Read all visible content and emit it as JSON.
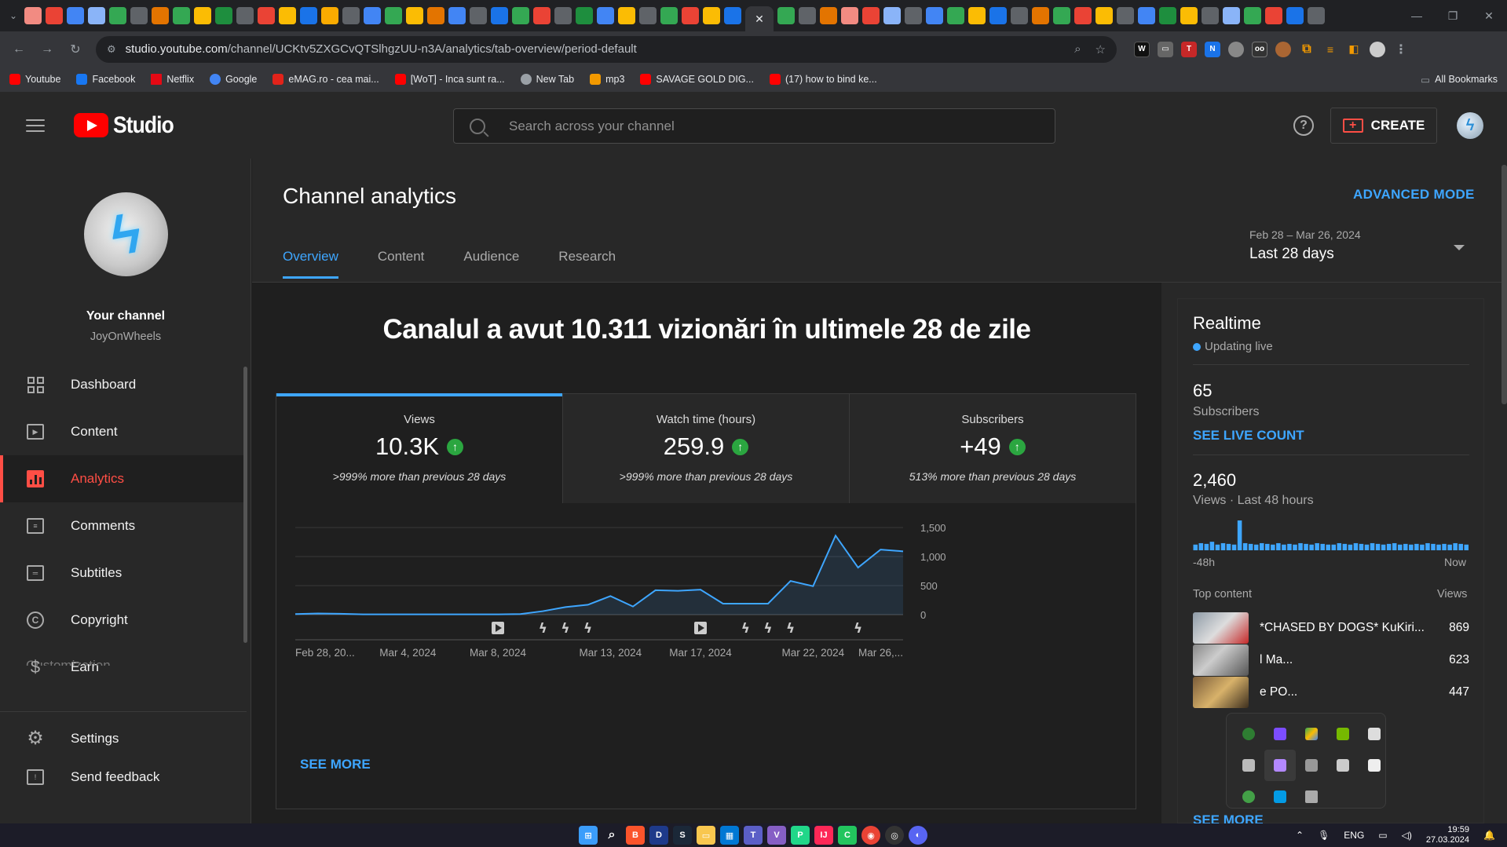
{
  "browser": {
    "url_host": "studio.youtube.com",
    "url_path": "/channel/UCKtv5ZXGCvQTSlhgzUU-n3A/analytics/tab-overview/period-default",
    "tab_favicons": [
      "#f28b82",
      "#ea4335",
      "#4285f4",
      "#8ab4f8",
      "#34a853",
      "#5f6368",
      "#e37400",
      "#34a853",
      "#fbbc04",
      "#1e8e3e",
      "#5f6368",
      "#ea4335",
      "#fbbc04",
      "#1a73e8",
      "#f9ab00",
      "#5f6368",
      "#4285f4",
      "#34a853",
      "#fbbc04",
      "#e37400",
      "#4285f4",
      "#5f6368",
      "#1a73e8",
      "#34a853",
      "#ea4335",
      "#5f6368",
      "#1e8e3e",
      "#4285f4",
      "#fbbc04",
      "#5f6368",
      "#34a853",
      "#ea4335",
      "#fbbc04",
      "#1a73e8",
      "#34a853",
      "#5f6368",
      "#e37400",
      "#f28b82",
      "#ea4335",
      "#8ab4f8",
      "#5f6368",
      "#4285f4",
      "#34a853",
      "#fbbc04",
      "#1a73e8",
      "#5f6368",
      "#e37400",
      "#34a853",
      "#ea4335",
      "#fbbc04",
      "#5f6368",
      "#4285f4",
      "#1e8e3e",
      "#fbbc04",
      "#5f6368",
      "#8ab4f8",
      "#34a853",
      "#ea4335",
      "#1a73e8",
      "#5f6368"
    ],
    "bookmarks": [
      {
        "label": "Youtube",
        "color": "#ff0000"
      },
      {
        "label": "Facebook",
        "color": "#1877f2"
      },
      {
        "label": "Netflix",
        "color": "#e50914"
      },
      {
        "label": "Google",
        "color": "#4285f4"
      },
      {
        "label": "eMAG.ro - cea mai...",
        "color": "#e2231a"
      },
      {
        "label": "[WoT] - Inca sunt ra...",
        "color": "#ff0000"
      },
      {
        "label": "New Tab",
        "color": "#9aa0a6"
      },
      {
        "label": "mp3",
        "color": "#f29900"
      },
      {
        "label": "SAVAGE GOLD DIG...",
        "color": "#ff0000"
      },
      {
        "label": "(17) how to bind ke...",
        "color": "#ff0000"
      }
    ],
    "all_bookmarks": "All Bookmarks"
  },
  "header": {
    "logo_text": "Studio",
    "search_placeholder": "Search across your channel",
    "create_label": "CREATE"
  },
  "sidebar": {
    "your_channel": "Your channel",
    "channel_name": "JoyOnWheels",
    "items": [
      {
        "label": "Dashboard",
        "icon": "dashboard-icon",
        "active": false
      },
      {
        "label": "Content",
        "icon": "content-icon",
        "active": false
      },
      {
        "label": "Analytics",
        "icon": "analytics-icon",
        "active": true
      },
      {
        "label": "Comments",
        "icon": "comments-icon",
        "active": false
      },
      {
        "label": "Subtitles",
        "icon": "subtitles-icon",
        "active": false
      },
      {
        "label": "Copyright",
        "icon": "copyright-icon",
        "active": false
      },
      {
        "label": "Earn",
        "icon": "earn-icon",
        "active": false
      }
    ],
    "partial_item": "Customization",
    "bottom_items": [
      {
        "label": "Settings",
        "icon": "settings-icon"
      },
      {
        "label": "Send feedback",
        "icon": "feedback-icon"
      }
    ]
  },
  "main": {
    "title": "Channel analytics",
    "advanced_mode": "ADVANCED MODE",
    "tabs": [
      "Overview",
      "Content",
      "Audience",
      "Research"
    ],
    "active_tab": "Overview",
    "period_range": "Feb 28 – Mar 26, 2024",
    "period_label": "Last 28 days",
    "headline": "Canalul a avut 10.311 vizionări în ultimele 28 de zile",
    "metrics": [
      {
        "label": "Views",
        "value": "10.3K",
        "sub": ">999% more than previous 28 days",
        "active": true
      },
      {
        "label": "Watch time (hours)",
        "value": "259.9",
        "sub": ">999% more than previous 28 days",
        "active": false
      },
      {
        "label": "Subscribers",
        "value": "+49",
        "sub": "513% more than previous 28 days",
        "active": false
      }
    ],
    "see_more": "SEE MORE"
  },
  "chart_data": {
    "type": "area",
    "title": "",
    "xlabel": "",
    "ylabel": "",
    "ylim": [
      0,
      1500
    ],
    "yticks": [
      "1,500",
      "1,000",
      "500",
      "0"
    ],
    "x_tick_labels": [
      "Feb 28, 20...",
      "Mar 4, 2024",
      "Mar 8, 2024",
      "Mar 13, 2024",
      "Mar 17, 2024",
      "Mar 22, 2024",
      "Mar 26,..."
    ],
    "x": [
      "Feb 28",
      "Feb 29",
      "Mar 1",
      "Mar 2",
      "Mar 3",
      "Mar 4",
      "Mar 5",
      "Mar 6",
      "Mar 7",
      "Mar 8",
      "Mar 9",
      "Mar 10",
      "Mar 11",
      "Mar 12",
      "Mar 13",
      "Mar 14",
      "Mar 15",
      "Mar 16",
      "Mar 17",
      "Mar 18",
      "Mar 19",
      "Mar 20",
      "Mar 21",
      "Mar 22",
      "Mar 23",
      "Mar 24",
      "Mar 25",
      "Mar 26"
    ],
    "values": [
      10,
      20,
      15,
      5,
      5,
      5,
      5,
      5,
      5,
      5,
      10,
      60,
      130,
      170,
      320,
      140,
      420,
      410,
      430,
      190,
      190,
      190,
      580,
      490,
      1360,
      810,
      1120,
      1090
    ],
    "values_tail_note": "",
    "grid": true,
    "color": "#3ea6ff",
    "markers": [
      {
        "x": "Mar 8",
        "kind": "video"
      },
      {
        "x": "Mar 10",
        "kind": "short"
      },
      {
        "x": "Mar 11",
        "kind": "short"
      },
      {
        "x": "Mar 12",
        "kind": "short"
      },
      {
        "x": "Mar 17",
        "kind": "video"
      },
      {
        "x": "Mar 19",
        "kind": "short"
      },
      {
        "x": "Mar 20",
        "kind": "short"
      },
      {
        "x": "Mar 21",
        "kind": "short"
      },
      {
        "x": "Mar 24",
        "kind": "short"
      }
    ]
  },
  "realtime": {
    "title": "Realtime",
    "live": "Updating live",
    "subs_value": "65",
    "subs_label": "Subscribers",
    "see_live_count": "SEE LIVE COUNT",
    "views_value": "2,460",
    "views_label": "Views · Last 48 hours",
    "axis_left": "-48h",
    "axis_right": "Now",
    "bars": [
      8,
      10,
      9,
      12,
      8,
      10,
      9,
      8,
      42,
      10,
      9,
      8,
      10,
      9,
      8,
      10,
      8,
      9,
      8,
      10,
      9,
      8,
      10,
      9,
      8,
      8,
      10,
      9,
      8,
      10,
      9,
      8,
      10,
      9,
      8,
      9,
      10,
      8,
      9,
      8,
      9,
      8,
      10,
      9,
      8,
      9,
      8,
      10,
      9,
      8
    ],
    "top_content_label": "Top content",
    "top_views_label": "Views",
    "top_items": [
      {
        "title": "*CHASED BY DOGS* KuKiri...",
        "views": "869"
      },
      {
        "title": "l Ma...",
        "views": "623"
      },
      {
        "title": "e PO...",
        "views": "447"
      }
    ],
    "see_more": "SEE MORE"
  },
  "taskbar": {
    "language": "ENG",
    "time": "19:59",
    "date": "27.03.2024"
  }
}
